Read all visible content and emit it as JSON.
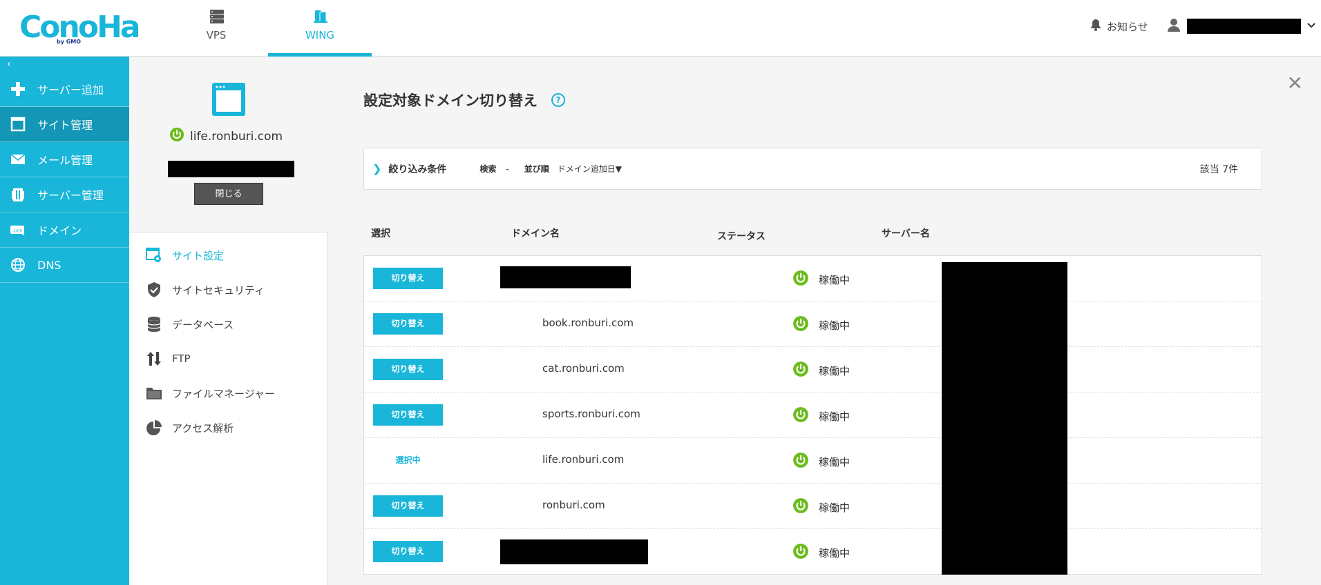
{
  "header": {
    "logo_word": "ConoHa",
    "logo_by": "by GMO",
    "tabs": [
      {
        "label": "VPS",
        "icon": "server-stack-icon"
      },
      {
        "label": "WING",
        "icon": "mobile-stack-icon"
      }
    ],
    "notice_label": "お知らせ"
  },
  "sidebar": {
    "collapse_glyph": "‹",
    "items": [
      {
        "label": "サーバー追加",
        "icon": "plus-icon"
      },
      {
        "label": "サイト管理",
        "icon": "window-icon"
      },
      {
        "label": "メール管理",
        "icon": "mail-icon"
      },
      {
        "label": "サーバー管理",
        "icon": "server-icon"
      },
      {
        "label": "ドメイン",
        "icon": "domain-icon"
      },
      {
        "label": "DNS",
        "icon": "globe-icon"
      }
    ]
  },
  "site_panel": {
    "domain": "life.ronburi.com",
    "close_label": "閉じる",
    "menu": [
      {
        "label": "サイト設定",
        "icon": "site-settings-icon"
      },
      {
        "label": "サイトセキュリティ",
        "icon": "shield-icon"
      },
      {
        "label": "データベース",
        "icon": "database-icon"
      },
      {
        "label": "FTP",
        "icon": "transfer-arrows-icon"
      },
      {
        "label": "ファイルマネージャー",
        "icon": "folder-icon"
      },
      {
        "label": "アクセス解析",
        "icon": "pie-chart-icon"
      }
    ]
  },
  "main": {
    "title": "設定対象ドメイン切り替え",
    "help_glyph": "?",
    "close_glyph": "✕",
    "filter": {
      "chevron": "❯",
      "title": "絞り込み条件",
      "search_label": "検索",
      "search_value": "-",
      "sort_label": "並び順",
      "sort_value": "ドメイン追加日▼",
      "count": "該当 7件"
    },
    "columns": [
      "選択",
      "ドメイン名",
      "ステータス",
      "サーバー名"
    ],
    "rows": [
      {
        "action": "切り替え",
        "domain": "",
        "status": "稼働中"
      },
      {
        "action": "切り替え",
        "domain": "book.ronburi.com",
        "status": "稼働中"
      },
      {
        "action": "切り替え",
        "domain": "cat.ronburi.com",
        "status": "稼働中"
      },
      {
        "action": "切り替え",
        "domain": "sports.ronburi.com",
        "status": "稼働中"
      },
      {
        "action": "選択中",
        "domain": "life.ronburi.com",
        "status": "稼働中"
      },
      {
        "action": "切り替え",
        "domain": "ronburi.com",
        "status": "稼働中"
      },
      {
        "action": "切り替え",
        "domain": "",
        "status": "稼働中"
      }
    ]
  },
  "colors": {
    "accent": "#19b6d9",
    "accent_dark": "#1497b6",
    "status_green": "#6dbb1e",
    "close_button": "#555555"
  }
}
